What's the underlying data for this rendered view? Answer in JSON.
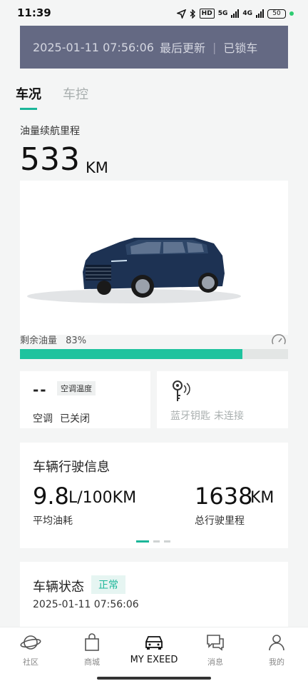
{
  "status_bar": {
    "time": "11:39",
    "net1": "5G",
    "net2": "4G",
    "hd": "HD",
    "battery": "50"
  },
  "update_banner": {
    "datetime": "2025-01-11 07:56:06",
    "update_label": "最后更新",
    "lock_state": "已锁车"
  },
  "tabs": [
    {
      "label": "车况",
      "active": true
    },
    {
      "label": "车控",
      "active": false
    }
  ],
  "range": {
    "label": "油量续航里程",
    "value": "533",
    "unit": "KM"
  },
  "fuel": {
    "label": "剩余油量",
    "percent_text": "83%",
    "percent": 0.83
  },
  "ac": {
    "temp_value": "--",
    "temp_label": "空调温度",
    "label": "空调",
    "state": "已关闭"
  },
  "bluetooth_key": {
    "label": "蓝牙钥匙",
    "state": "未连接"
  },
  "driving_info": {
    "title": "车辆行驶信息",
    "avg_fuel_value": "9.8",
    "avg_fuel_unit": "L/100KM",
    "avg_fuel_label": "平均油耗",
    "odometer_value": "1638",
    "odometer_unit": "KM",
    "odometer_label": "总行驶里程"
  },
  "vehicle_status": {
    "title": "车辆状态",
    "badge": "正常",
    "datetime": "2025-01-11 07:56:06"
  },
  "bottom_nav": [
    {
      "label": "社区",
      "icon": "planet-icon"
    },
    {
      "label": "商城",
      "icon": "shopping-bag-icon"
    },
    {
      "label": "MY EXEED",
      "icon": "car-icon",
      "active": true
    },
    {
      "label": "消息",
      "icon": "chat-icon"
    },
    {
      "label": "我的",
      "icon": "user-icon"
    }
  ],
  "colors": {
    "accent": "#1bb699",
    "fuel_bar": "#1ec39e",
    "banner_bg": "#646983"
  }
}
